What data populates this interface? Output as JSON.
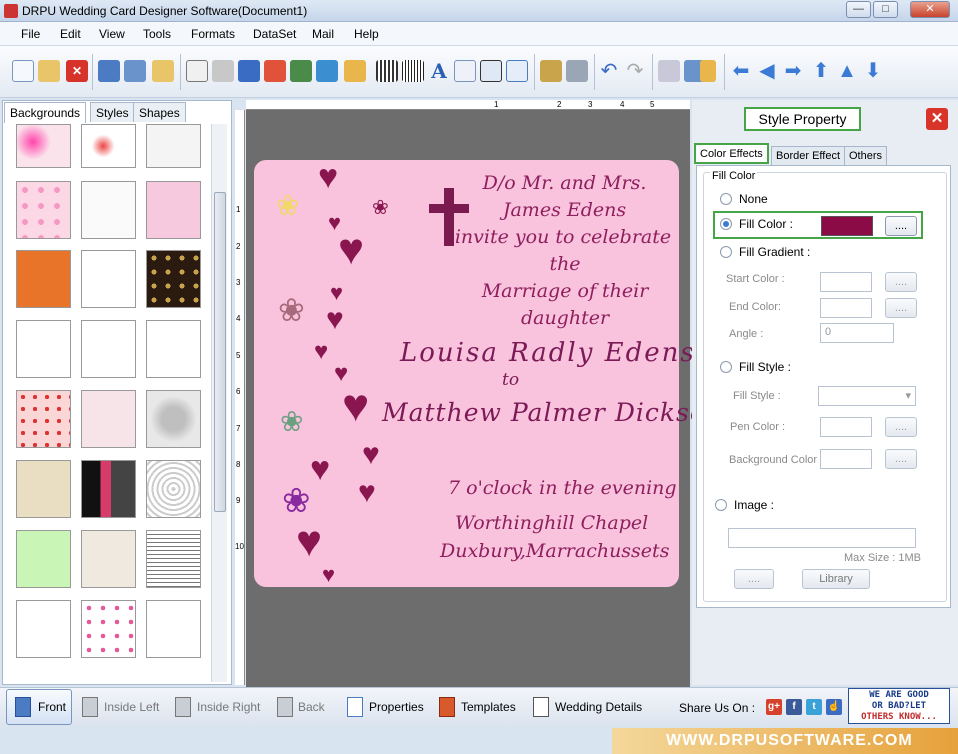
{
  "window": {
    "title": "DRPU Wedding Card Designer Software(Document1)"
  },
  "menu": [
    "File",
    "Edit",
    "View",
    "Tools",
    "Formats",
    "DataSet",
    "Mail",
    "Help"
  ],
  "left_tabs": [
    "Backgrounds",
    "Styles",
    "Shapes"
  ],
  "ruler": {
    "h": [
      "1",
      "2",
      "3",
      "4",
      "5"
    ],
    "v": [
      "1",
      "2",
      "3",
      "4",
      "5",
      "6",
      "7",
      "8",
      "9",
      "10"
    ]
  },
  "card": {
    "line1": "D/o Mr. and Mrs.",
    "line2": "James Edens",
    "line3": "invite you to celebrate",
    "line4": "the",
    "line5": "Marriage of their",
    "line6": "daughter",
    "bride": "Louisa Radly Edens",
    "to": "to",
    "groom": "Matthew Palmer Dickson",
    "time": "7 o'clock in the evening",
    "venue": "Worthinghill Chapel",
    "city": "Duxbury,Marrachussets"
  },
  "style_panel": {
    "header": "Style Property",
    "tabs": [
      "Color Effects",
      "Border Effect",
      "Others"
    ],
    "group": "Fill Color",
    "none": "None",
    "fill_color": "Fill Color :",
    "fill_color_value": "#8a0b45",
    "fill_gradient": "Fill Gradient :",
    "start_color": "Start Color :",
    "end_color": "End Color:",
    "angle": "Angle :",
    "angle_value": "0",
    "fill_style_radio": "Fill Style :",
    "fill_style": "Fill Style :",
    "pen_color": "Pen Color :",
    "background_color": "Background Color :",
    "image": "Image :",
    "max_size": "Max Size : 1MB",
    "browse": "....",
    "library": "Library"
  },
  "bottom": {
    "front": "Front",
    "inside_left": "Inside Left",
    "inside_right": "Inside Right",
    "back": "Back",
    "properties": "Properties",
    "templates": "Templates",
    "wedding_details": "Wedding Details",
    "share": "Share Us On :",
    "badge_l1": "WE ARE GOOD",
    "badge_l2": "OR BAD?LET",
    "badge_l3": "OTHERS KNOW..."
  },
  "footer": {
    "url": "WWW.DRPUSOFTWARE.COM"
  },
  "colors": {
    "card_bg": "#f9c3dd",
    "text": "#8e1f5e",
    "accent_green": "#46a546"
  }
}
